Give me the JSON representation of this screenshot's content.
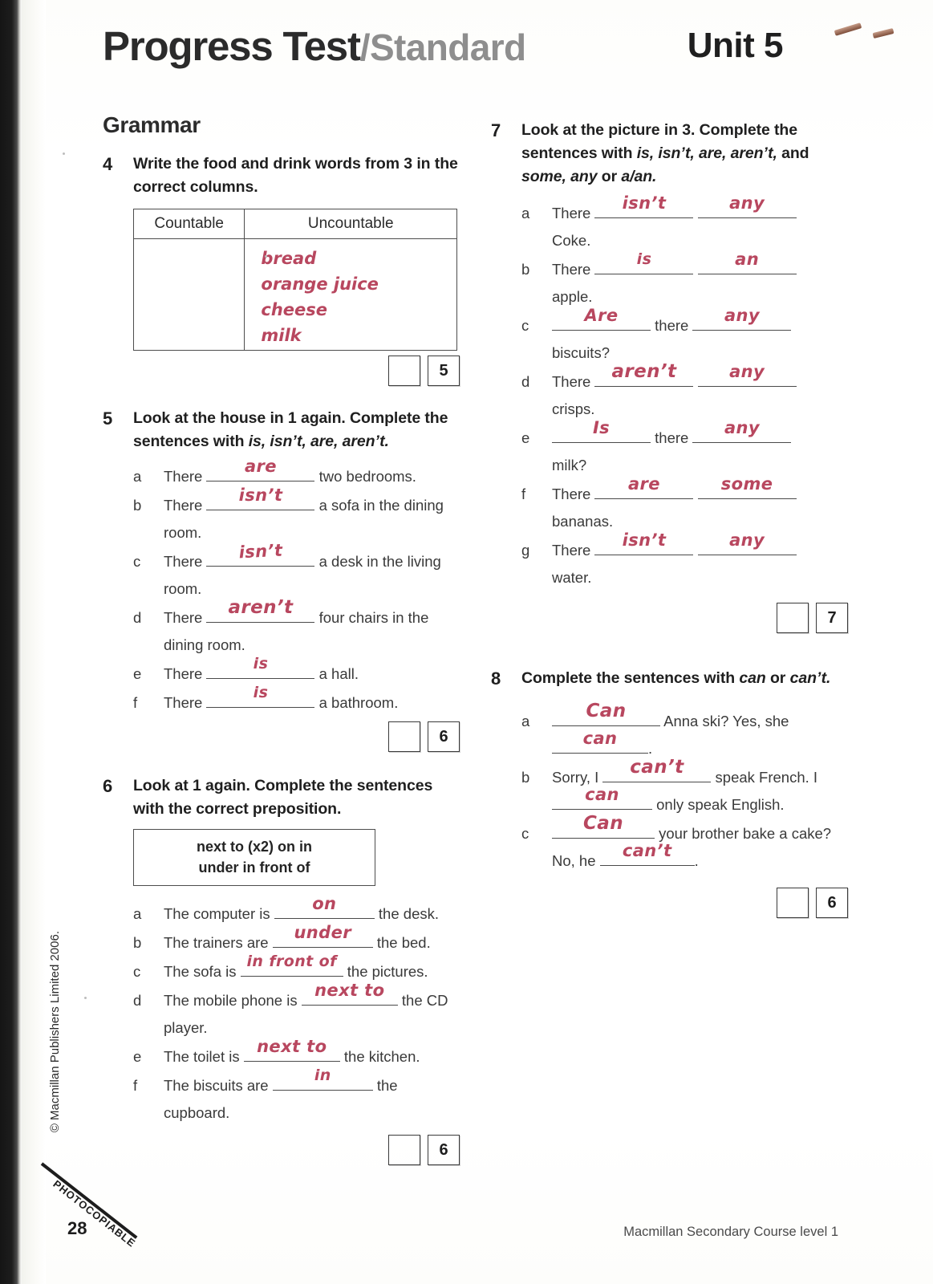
{
  "header": {
    "title_main": "Progress Test",
    "title_divider": "/",
    "title_sub": "Standard",
    "unit": "Unit 5"
  },
  "section_heading": "Grammar",
  "exercises": [
    {
      "number": "4",
      "prompt_parts": [
        {
          "text": "Write the food and drink words from 3 in the correct columns.",
          "italic": false
        }
      ],
      "table": {
        "headers": [
          "Countable",
          "Uncountable"
        ],
        "countable_answers": [],
        "uncountable_answers": [
          "bread",
          "orange juice",
          "cheese",
          "milk"
        ]
      },
      "score": {
        "student": "",
        "max": "5"
      }
    },
    {
      "number": "5",
      "prompt_parts": [
        {
          "text": "Look at the house in 1 again. Complete the sentences with ",
          "italic": false
        },
        {
          "text": "is, isn’t, are, aren’t.",
          "italic": true
        }
      ],
      "items": [
        {
          "letter": "a",
          "pre": "There",
          "answer": "are",
          "post": "two bedrooms."
        },
        {
          "letter": "b",
          "pre": "There",
          "answer": "isn’t",
          "post": "a sofa in the dining room."
        },
        {
          "letter": "c",
          "pre": "There",
          "answer": "isn’t",
          "post": "a desk in the living room."
        },
        {
          "letter": "d",
          "pre": "There",
          "answer": "aren’t",
          "post": "four chairs in the dining room."
        },
        {
          "letter": "e",
          "pre": "There",
          "answer": "is",
          "post": "a hall."
        },
        {
          "letter": "f",
          "pre": "There",
          "answer": "is",
          "post": "a bathroom."
        }
      ],
      "score": {
        "student": "",
        "max": "6"
      }
    },
    {
      "number": "6",
      "prompt_parts": [
        {
          "text": "Look at 1 again. Complete the sentences with the correct preposition.",
          "italic": false
        }
      ],
      "wordbox": {
        "line1": "next to (x2)    on    in",
        "line2": "under    in front of"
      },
      "items": [
        {
          "letter": "a",
          "pre": "The computer is",
          "answer": "on",
          "post": "the desk."
        },
        {
          "letter": "b",
          "pre": "The trainers are",
          "answer": "under",
          "post": "the bed."
        },
        {
          "letter": "c",
          "pre": "The sofa is",
          "answer": "in front of",
          "post": "the pictures."
        },
        {
          "letter": "d",
          "pre": "The mobile phone is",
          "answer": "next to",
          "post": "the CD player."
        },
        {
          "letter": "e",
          "pre": "The toilet is",
          "answer": "next to",
          "post": "the kitchen."
        },
        {
          "letter": "f",
          "pre": "The biscuits are",
          "answer": "in",
          "post": "the cupboard."
        }
      ],
      "score": {
        "student": "",
        "max": "6"
      }
    },
    {
      "number": "7",
      "prompt_parts": [
        {
          "text": "Look at the picture in 3. Complete the sentences with ",
          "italic": false
        },
        {
          "text": "is, isn’t, are, aren’t,",
          "italic": true
        },
        {
          "text": " and ",
          "italic": false
        },
        {
          "text": "some, any",
          "italic": true
        },
        {
          "text": " or ",
          "italic": false
        },
        {
          "text": "a/an.",
          "italic": true
        }
      ],
      "items": [
        {
          "letter": "a",
          "pre": "There",
          "answer1": "isn’t",
          "mid": "",
          "answer2": "any",
          "post": "Coke."
        },
        {
          "letter": "b",
          "pre": "There",
          "answer1": "is",
          "mid": "",
          "answer2": "an",
          "post": "apple."
        },
        {
          "letter": "c",
          "pre": "",
          "answer1": "Are",
          "mid": "there",
          "answer2": "any",
          "post": "biscuits?"
        },
        {
          "letter": "d",
          "pre": "There",
          "answer1": "aren’t",
          "mid": "",
          "answer2": "any",
          "post": "crisps."
        },
        {
          "letter": "e",
          "pre": "",
          "answer1": "Is",
          "mid": "there",
          "answer2": "any",
          "post": "milk?"
        },
        {
          "letter": "f",
          "pre": "There",
          "answer1": "are",
          "mid": "",
          "answer2": "some",
          "post": "bananas."
        },
        {
          "letter": "g",
          "pre": "There",
          "answer1": "isn’t",
          "mid": "",
          "answer2": "any",
          "post": "water."
        }
      ],
      "score": {
        "student": "",
        "max": "7"
      }
    },
    {
      "number": "8",
      "prompt_parts": [
        {
          "text": "Complete the sentences with ",
          "italic": false
        },
        {
          "text": "can",
          "italic": true
        },
        {
          "text": " or ",
          "italic": false
        },
        {
          "text": "can’t.",
          "italic": true
        }
      ],
      "items": [
        {
          "letter": "a",
          "pre": "",
          "answer1": "Can",
          "mid": "Anna ski? Yes, she",
          "answer2": "can",
          "post": "."
        },
        {
          "letter": "b",
          "pre": "Sorry, I",
          "answer1": "can’t",
          "mid": "speak French. I",
          "answer2": "can",
          "post": "only speak English."
        },
        {
          "letter": "c",
          "pre": "",
          "answer1": "Can",
          "mid": "your brother bake a cake? No, he",
          "answer2": "can’t",
          "post": "."
        }
      ],
      "score": {
        "student": "",
        "max": "6"
      }
    }
  ],
  "copyright": "© Macmillan Publishers Limited 2006.",
  "photocopiable": "PHOTOCOPIABLE",
  "page_number": "28",
  "footer_note": "Macmillan Secondary Course level 1",
  "colors": {
    "handwriting_ink": "#b8475f",
    "title_main": "#2b2b2b",
    "title_sub": "#8e8e8e",
    "body_text": "#3a3a3a"
  }
}
